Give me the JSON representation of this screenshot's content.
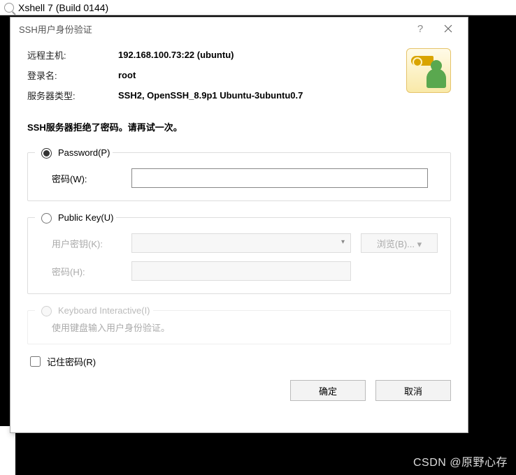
{
  "terminal": {
    "title": "Xshell 7 (Build 0144)"
  },
  "dialog": {
    "title": "SSH用户身份验证",
    "info": {
      "remote_host_label": "远程主机:",
      "remote_host_value": "192.168.100.73:22 (ubuntu)",
      "login_label": "登录名:",
      "login_value": "root",
      "server_type_label": "服务器类型:",
      "server_type_value": "SSH2, OpenSSH_8.9p1 Ubuntu-3ubuntu0.7"
    },
    "error": "SSH服务器拒绝了密码。请再试一次。",
    "password_group": {
      "radio_label": "Password(P)",
      "pw_label": "密码(W):",
      "pw_value": ""
    },
    "publickey_group": {
      "radio_label": "Public Key(U)",
      "userkey_label": "用户密钥(K):",
      "userkey_value": "",
      "browse_label": "浏览(B)... ▾",
      "pw_label": "密码(H):",
      "pw_value": ""
    },
    "kbd_group": {
      "radio_label": "Keyboard Interactive(I)",
      "hint": "使用键盘输入用户身份验证。"
    },
    "remember_label": "记住密码(R)",
    "ok_label": "确定",
    "cancel_label": "取消"
  },
  "watermark": "CSDN @原野心存"
}
